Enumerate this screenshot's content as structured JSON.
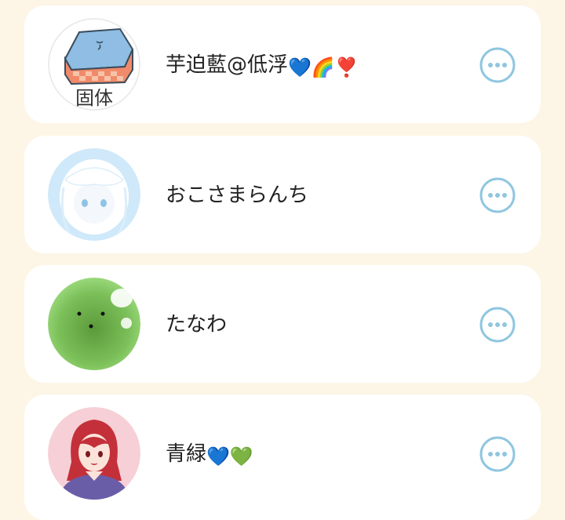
{
  "friends": [
    {
      "name": "芋迫藍@低浮",
      "emojis": [
        "💙",
        "🌈",
        "❣️"
      ],
      "avatar_text": "固体",
      "avatar_icon": "ice-block-avatar",
      "more_icon": "more-options-icon"
    },
    {
      "name": "おこさまらんち",
      "emojis": [],
      "avatar_icon": "white-hair-character-avatar",
      "more_icon": "more-options-icon"
    },
    {
      "name": "たなわ",
      "emojis": [],
      "avatar_icon": "green-slime-avatar",
      "more_icon": "more-options-icon"
    },
    {
      "name": "青緑",
      "emojis": [
        "💙",
        "💚"
      ],
      "avatar_icon": "red-hair-girl-avatar",
      "more_icon": "more-options-icon"
    }
  ],
  "colors": {
    "background": "#fdf5e6",
    "card": "#ffffff",
    "more_icon": "#8fc6e0",
    "text": "#222222"
  }
}
